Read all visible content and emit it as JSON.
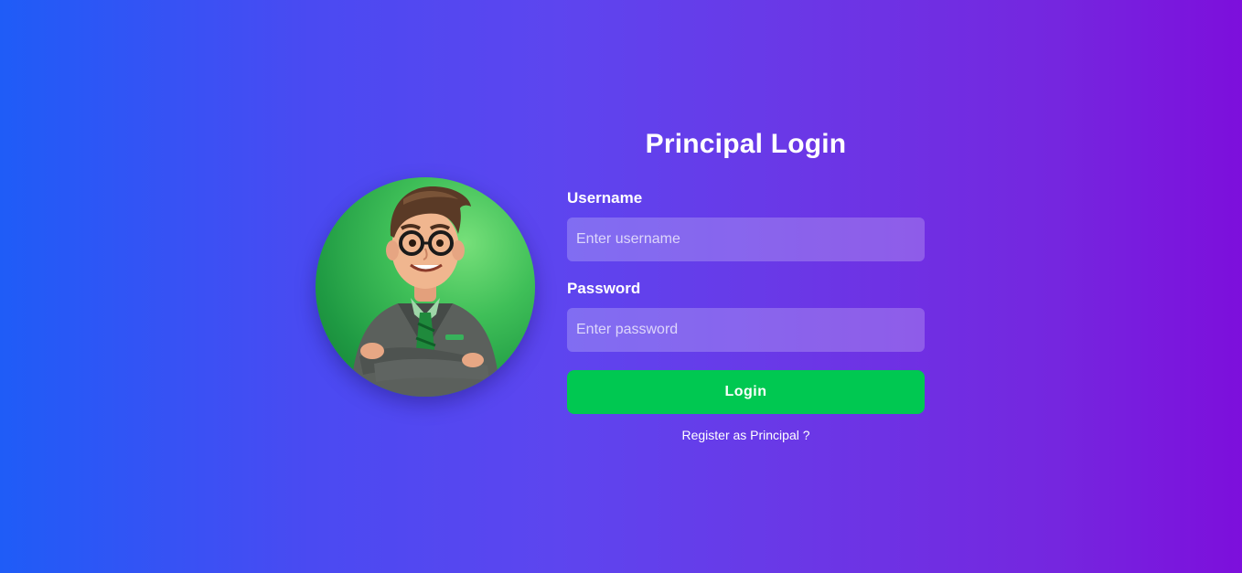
{
  "login": {
    "title": "Principal Login",
    "username_label": "Username",
    "username_placeholder": "Enter username",
    "username_value": "",
    "password_label": "Password",
    "password_placeholder": "Enter password",
    "password_value": "",
    "submit_label": "Login",
    "register_link": "Register as Principal ?"
  },
  "avatar": {
    "icon": "principal-avatar-illustration"
  },
  "colors": {
    "gradient_start": "#1f5cf7",
    "gradient_end": "#7d0fdc",
    "button": "#00c851",
    "avatar_bg": "#3fbf58"
  }
}
